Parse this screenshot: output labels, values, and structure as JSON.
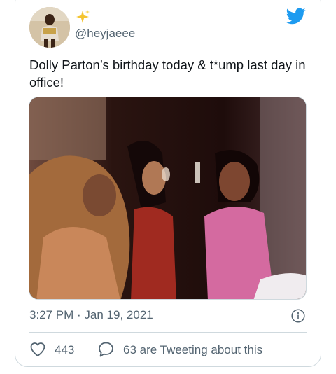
{
  "tweet": {
    "handle": "@heyjaeee",
    "text": "Dolly Parton’s birthday today & t*ump last day in office!",
    "timestamp": "3:27 PM · Jan 19, 2021",
    "like_count": "443",
    "reply_text": "63 are Tweeting about this"
  },
  "icons": {
    "brand": "twitter-bird-icon",
    "info": "info-icon",
    "like": "heart-icon",
    "reply": "speech-bubble-icon",
    "name_emoji": "sparkles-icon"
  },
  "colors": {
    "twitter_blue": "#1d9bf0",
    "secondary_text": "#536471",
    "border": "#cfd9de",
    "sparkle": "#f4c430"
  }
}
